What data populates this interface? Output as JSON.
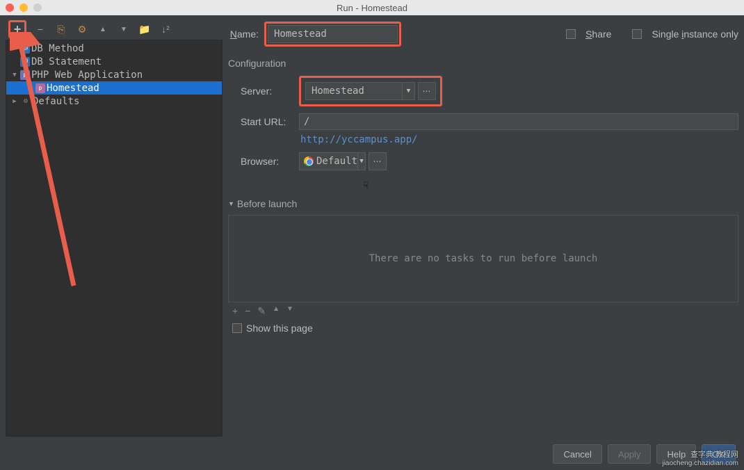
{
  "window": {
    "title": "Run - Homestead"
  },
  "tree": {
    "items": [
      {
        "label": "DB Method",
        "indent": 1
      },
      {
        "label": "DB Statement",
        "indent": 1
      },
      {
        "label": "PHP Web Application",
        "indent": 1
      },
      {
        "label": "Homestead",
        "indent": 2,
        "selected": true
      },
      {
        "label": "Defaults",
        "indent": 0
      }
    ]
  },
  "form": {
    "name_label": "Name:",
    "name_value": "Homestead",
    "share_label": "Share",
    "single_instance_label": "Single instance only",
    "config_heading": "Configuration",
    "server_label": "Server:",
    "server_value": "Homestead",
    "start_url_label": "Start URL:",
    "start_url_value": "/",
    "start_url_resolved": "http://yccampus.app/",
    "browser_label": "Browser:",
    "browser_value": "Default",
    "before_launch_label": "Before launch",
    "before_launch_empty": "There are no tasks to run before launch",
    "show_page_label": "Show this page"
  },
  "buttons": {
    "cancel": "Cancel",
    "apply": "Apply",
    "help": "Help",
    "ok": "OK"
  },
  "watermark": {
    "line1": "查字典 教程网",
    "line2": "jiaocheng.chazidian.com"
  }
}
